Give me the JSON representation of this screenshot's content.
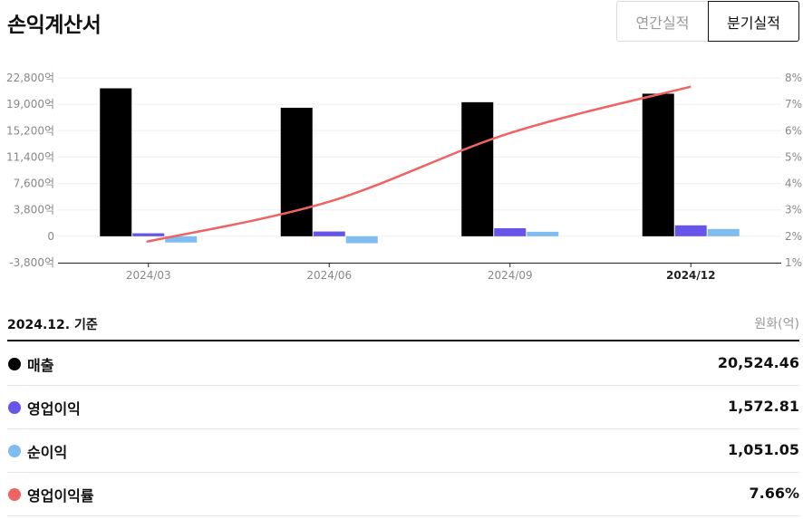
{
  "header": {
    "title": "손익계산서",
    "tabs": [
      {
        "label": "연간실적",
        "active": false
      },
      {
        "label": "분기실적",
        "active": true
      }
    ]
  },
  "chart_data": {
    "type": "bar",
    "categories": [
      "2024/03",
      "2024/06",
      "2024/09",
      "2024/12"
    ],
    "highlight_category": "2024/12",
    "series": [
      {
        "name": "매출",
        "kind": "bar",
        "axis": "left",
        "color": "#000000",
        "values": [
          21300,
          18500,
          19300,
          20524.46
        ]
      },
      {
        "name": "영업이익",
        "kind": "bar",
        "axis": "left",
        "color": "#6655e8",
        "values": [
          430,
          690,
          1160,
          1572.81
        ]
      },
      {
        "name": "순이익",
        "kind": "bar",
        "axis": "left",
        "color": "#7fbcf0",
        "values": [
          -900,
          -1000,
          650,
          1051.05
        ]
      },
      {
        "name": "영업이익률",
        "kind": "line",
        "axis": "right",
        "color": "#ef6363",
        "values": [
          1.8,
          3.3,
          5.9,
          7.66
        ]
      }
    ],
    "y_left": {
      "ticks": [
        22800,
        19000,
        15200,
        11400,
        7600,
        3800,
        0,
        -3800
      ],
      "tick_labels": [
        "22,800억",
        "19,000억",
        "15,200억",
        "11,400억",
        "7,600억",
        "3,800억",
        "0",
        "-3,800억"
      ],
      "ylim": [
        -3800,
        22800
      ]
    },
    "y_right": {
      "ticks": [
        8,
        7,
        6,
        5,
        4,
        3,
        2,
        1
      ],
      "tick_labels": [
        "8%",
        "7%",
        "6%",
        "5%",
        "4%",
        "3%",
        "2%",
        "1%"
      ],
      "ylim": [
        1,
        8
      ]
    },
    "grid": true
  },
  "summary": {
    "base_date": "2024.12. 기준",
    "unit": "원화(억)",
    "rows": [
      {
        "label": "매출",
        "value": "20,524.46",
        "color": "#000000"
      },
      {
        "label": "영업이익",
        "value": "1,572.81",
        "color": "#6655e8"
      },
      {
        "label": "순이익",
        "value": "1,051.05",
        "color": "#7fbcf0"
      },
      {
        "label": "영업이익률",
        "value": "7.66%",
        "color": "#ef6363"
      }
    ]
  }
}
